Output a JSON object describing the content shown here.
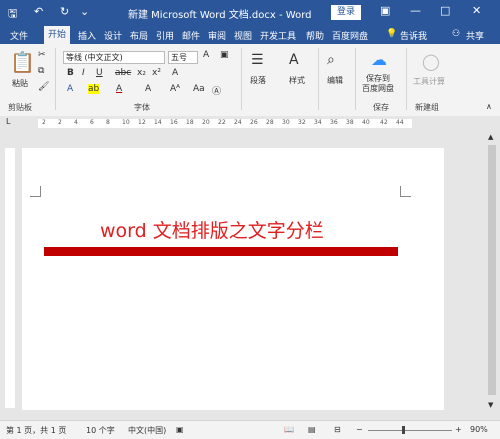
{
  "titlebar": {
    "title": "新建 Microsoft Word 文档.docx - Word",
    "login": "登录"
  },
  "tabs": [
    "文件",
    "开始",
    "插入",
    "设计",
    "布局",
    "引用",
    "邮件",
    "审阅",
    "视图",
    "开发工具",
    "帮助",
    "百度网盘",
    "告诉我",
    "共享"
  ],
  "ribbon": {
    "paste": "粘贴",
    "clipboard": "剪贴板",
    "font_name": "等线 (中文正文)",
    "font_size": "五号",
    "font_group": "字体",
    "paragraph": "段落",
    "styles": "样式",
    "editing": "编辑",
    "save_baidu": "保存到\n百度网盘",
    "save_group": "保存",
    "tool_calc": "工具计算",
    "new_group": "新建组"
  },
  "ruler": {
    "numbers": [
      "2",
      "2",
      "4",
      "6",
      "8",
      "10",
      "12",
      "14",
      "16",
      "18",
      "20",
      "22",
      "24",
      "26",
      "28",
      "30",
      "32",
      "34",
      "36",
      "38",
      "40",
      "42",
      "44"
    ]
  },
  "document": {
    "title": "word 文档排版之文字分栏"
  },
  "status": {
    "page": "第 1 页，共 1 页",
    "words": "10 个字",
    "lang": "中文(中国)",
    "zoom": "90%"
  },
  "colors": {
    "brand": "#2b579a",
    "title_red": "#e02020",
    "bar_red": "#c00000"
  }
}
